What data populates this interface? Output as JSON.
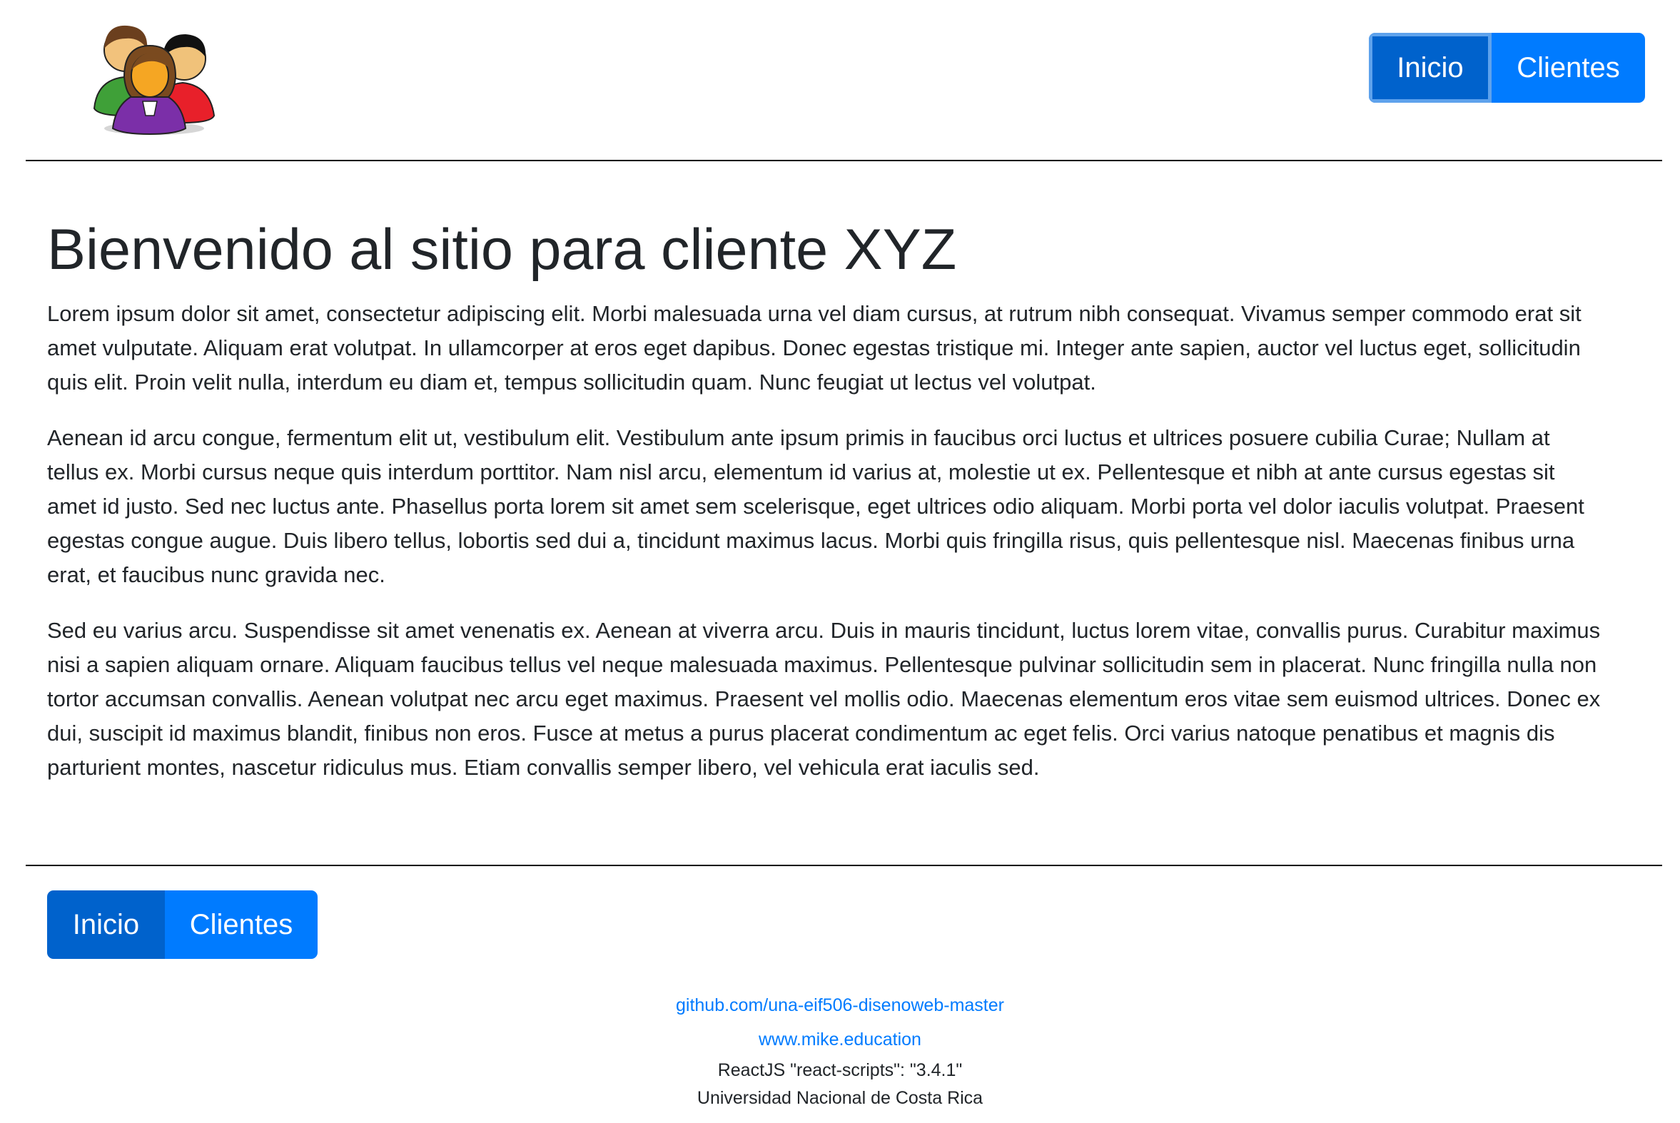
{
  "header": {
    "logo_icon": "group-of-people-icon",
    "nav": {
      "inicio": "Inicio",
      "clientes": "Clientes"
    }
  },
  "main": {
    "title": "Bienvenido al sitio para cliente XYZ",
    "paragraphs": [
      "Lorem ipsum dolor sit amet, consectetur adipiscing elit. Morbi malesuada urna vel diam cursus, at rutrum nibh consequat. Vivamus semper commodo erat sit amet vulputate. Aliquam erat volutpat. In ullamcorper at eros eget dapibus. Donec egestas tristique mi. Integer ante sapien, auctor vel luctus eget, sollicitudin quis elit. Proin velit nulla, interdum eu diam et, tempus sollicitudin quam. Nunc feugiat ut lectus vel volutpat.",
      "Aenean id arcu congue, fermentum elit ut, vestibulum elit. Vestibulum ante ipsum primis in faucibus orci luctus et ultrices posuere cubilia Curae; Nullam at tellus ex. Morbi cursus neque quis interdum porttitor. Nam nisl arcu, elementum id varius at, molestie ut ex. Pellentesque et nibh at ante cursus egestas sit amet id justo. Sed nec luctus ante. Phasellus porta lorem sit amet sem scelerisque, eget ultrices odio aliquam. Morbi porta vel dolor iaculis volutpat. Praesent egestas congue augue. Duis libero tellus, lobortis sed dui a, tincidunt maximus lacus. Morbi quis fringilla risus, quis pellentesque nisl. Maecenas finibus urna erat, et faucibus nunc gravida nec.",
      "Sed eu varius arcu. Suspendisse sit amet venenatis ex. Aenean at viverra arcu. Duis in mauris tincidunt, luctus lorem vitae, convallis purus. Curabitur maximus nisi a sapien aliquam ornare. Aliquam faucibus tellus vel neque malesuada maximus. Pellentesque pulvinar sollicitudin sem in placerat. Nunc fringilla nulla non tortor accumsan convallis. Aenean volutpat nec arcu eget maximus. Praesent vel mollis odio. Maecenas elementum eros vitae sem euismod ultrices. Donec ex dui, suscipit id maximus blandit, finibus non eros. Fusce at metus a purus placerat condimentum ac eget felis. Orci varius natoque penatibus et magnis dis parturient montes, nascetur ridiculus mus. Etiam convallis semper libero, vel vehicula erat iaculis sed."
    ]
  },
  "footer": {
    "nav": {
      "inicio": "Inicio",
      "clientes": "Clientes"
    },
    "links": [
      "github.com/una-eif506-disenoweb-master",
      "www.mike.education"
    ],
    "tech_line": "ReactJS \"react-scripts\": \"3.4.1\"",
    "university": "Universidad Nacional de Costa Rica"
  },
  "colors": {
    "primary": "#007bff",
    "primary_active": "#0062cc",
    "text": "#212529",
    "divider": "#000000"
  }
}
